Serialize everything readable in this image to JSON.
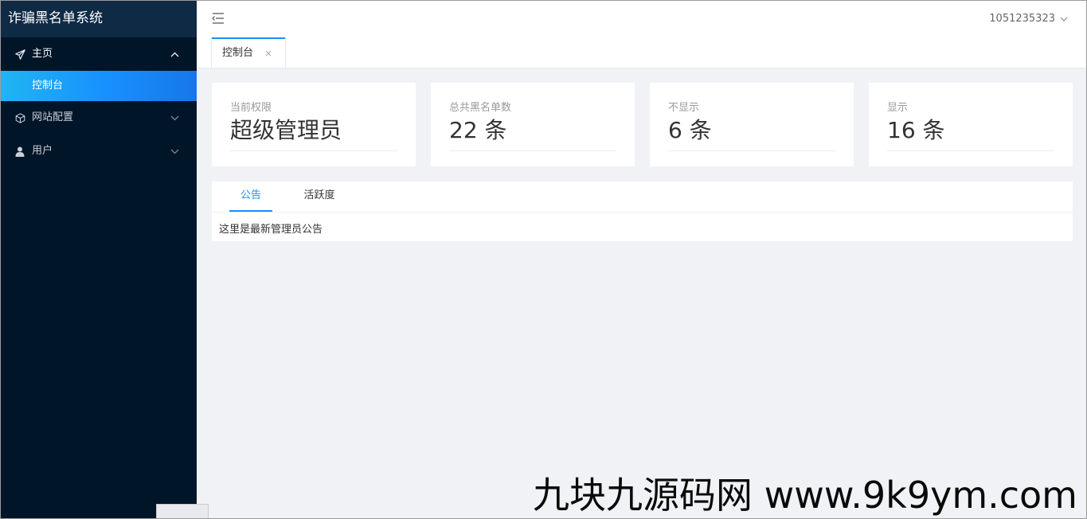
{
  "app": {
    "title": "诈骗黑名单系统"
  },
  "sidebar": {
    "items": [
      {
        "label": "主页",
        "icon": "paper-plane-icon",
        "expanded": true,
        "children": [
          {
            "label": "控制台",
            "active": true
          }
        ]
      },
      {
        "label": "网站配置",
        "icon": "cube-icon",
        "expanded": false
      },
      {
        "label": "用户",
        "icon": "user-icon",
        "expanded": false
      }
    ]
  },
  "header": {
    "username": "1051235323"
  },
  "tabs": [
    {
      "label": "控制台",
      "close": "×"
    }
  ],
  "stats": [
    {
      "label": "当前权限",
      "value": "超级管理员"
    },
    {
      "label": "总共黑名单数",
      "value": "22 条"
    },
    {
      "label": "不显示",
      "value": "6 条"
    },
    {
      "label": "显示",
      "value": "16 条"
    }
  ],
  "panel": {
    "tabs": [
      {
        "label": "公告",
        "active": true
      },
      {
        "label": "活跃度",
        "active": false
      }
    ],
    "content": "这里是最新管理员公告"
  },
  "watermark": "九块九源码网 www.9k9ym.com",
  "colors": {
    "accent": "#1890ff",
    "sidebar_bg": "#011529",
    "logo_bg": "#0f2a45",
    "page_bg": "#f0f2f5"
  }
}
